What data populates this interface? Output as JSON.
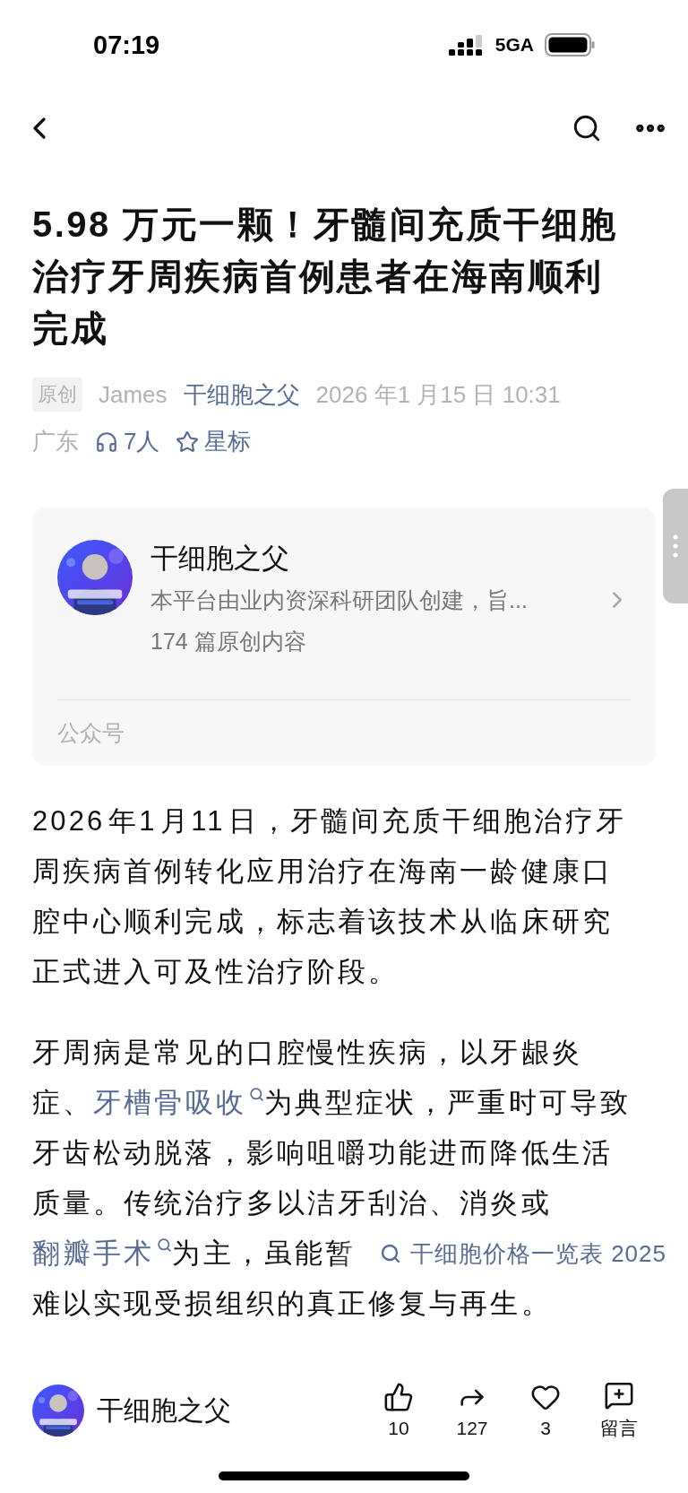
{
  "status_bar": {
    "time": "07:19",
    "network": "5GA"
  },
  "title": "5.98 万元一颗！牙髓间充质干细胞治疗牙周疾病首例患者在海南顺利完成",
  "meta": {
    "badge": "原创",
    "author": "James",
    "account": "干细胞之父",
    "date": "2026 年1 月15 日 10:31",
    "location": "广东",
    "listeners": "7人",
    "star": "星标"
  },
  "account_card": {
    "name": "干细胞之父",
    "description": "本平台由业内资深科研团队创建，旨...",
    "count": "174 篇原创内容",
    "footer": "公众号"
  },
  "paragraphs": [
    {
      "segments": [
        {
          "kind": "text",
          "text": "2026 年1 月11 日，牙髓间充质干细胞治疗牙周疾病首例转化应用治疗在海南一龄健康口腔中心顺利完成，标志着该技术从临床研究正式进入可及性治疗阶段。"
        }
      ]
    },
    {
      "segments": [
        {
          "kind": "text",
          "text": "牙周病是常见的口腔慢性疾病，以牙龈炎症、"
        },
        {
          "kind": "link",
          "text": "牙槽骨吸收"
        },
        {
          "kind": "text",
          "text": "为典型症状，严重时可导致牙齿松动脱落，影响咀嚼功能进而降低生活质量。传统治疗多以洁牙刮治、消炎或"
        },
        {
          "kind": "break"
        },
        {
          "kind": "link",
          "text": "翻瓣手术"
        },
        {
          "kind": "text",
          "text": "为主，虽能暂"
        },
        {
          "kind": "break"
        },
        {
          "kind": "text",
          "text": "难以实现受损组织的真正修复与再生。"
        }
      ]
    }
  ],
  "search_suggestion": "干细胞价格一览表 2025",
  "bottom_bar": {
    "name": "干细胞之父",
    "actions": [
      {
        "kind": "like",
        "count": "10"
      },
      {
        "kind": "share",
        "count": "127"
      },
      {
        "kind": "heart",
        "count": "3"
      },
      {
        "kind": "comment",
        "count": "留言"
      }
    ]
  }
}
